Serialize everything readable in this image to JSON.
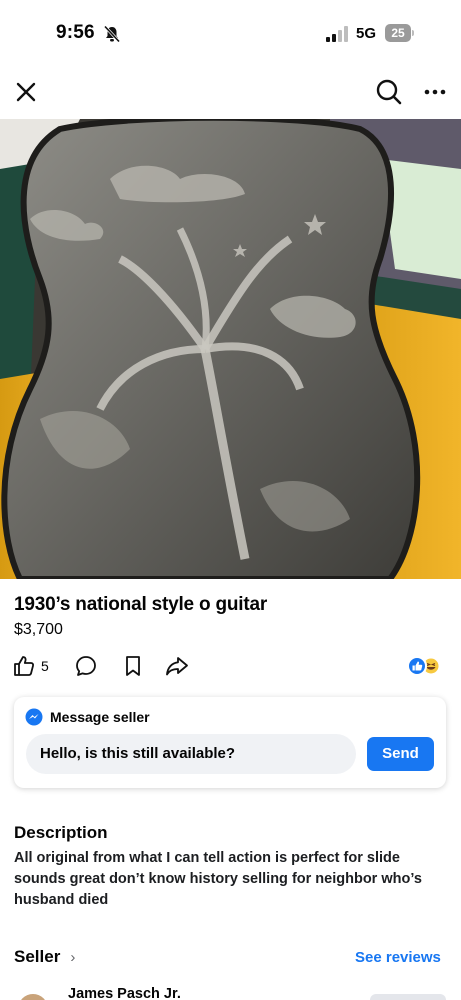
{
  "status_bar": {
    "time": "9:56",
    "network": "5G",
    "battery": "25"
  },
  "icons": {
    "close": "close-icon",
    "search": "search-icon",
    "more": "more-icon",
    "like": "thumbs-up-icon",
    "comment": "comment-icon",
    "save": "bookmark-icon",
    "share": "share-icon",
    "messenger": "messenger-icon"
  },
  "photo": {
    "page_count": 10,
    "active_index": 6
  },
  "listing": {
    "title": "1930’s national style o guitar",
    "price": "$3,700",
    "like_count": "5"
  },
  "message": {
    "header": "Message seller",
    "input_value": "Hello, is this still available?",
    "send_label": "Send"
  },
  "description": {
    "heading": "Description",
    "body": "All original from what I can tell  action is perfect for slide sounds great don’t know history selling for neighbor who’s husband died"
  },
  "seller": {
    "heading": "Seller",
    "see_reviews": "See reviews",
    "name": "James Pasch Jr."
  },
  "colors": {
    "accent": "#1877f2",
    "text": "#050505",
    "input_bg": "#f0f2f5"
  }
}
